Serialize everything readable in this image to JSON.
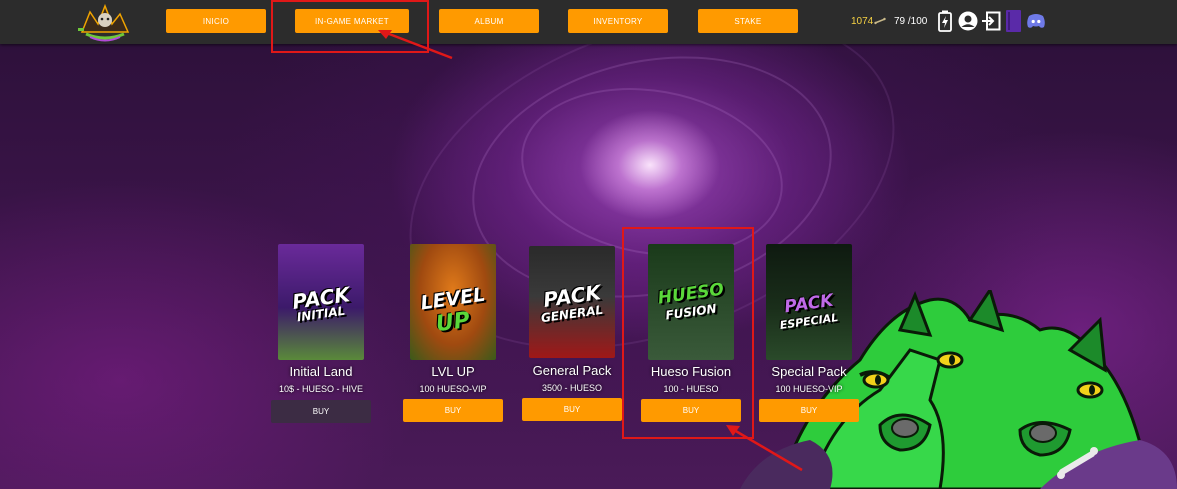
{
  "nav": {
    "items": [
      {
        "label": "INICIO"
      },
      {
        "label": "IN-GAME MARKET"
      },
      {
        "label": "ALBUM"
      },
      {
        "label": "INVENTORY"
      },
      {
        "label": "STAKE"
      }
    ]
  },
  "hud": {
    "currency_value": "1074",
    "energy": "79 /100"
  },
  "cards": [
    {
      "name": "Initial Land",
      "price": "10$ - HUESO - HIVE",
      "buy_label": "BUY",
      "pack_line1": "PACK",
      "pack_line2": "INITIAL"
    },
    {
      "name": "LVL UP",
      "price": "100 HUESO-VIP",
      "buy_label": "BUY",
      "pack_line1": "LEVEL",
      "pack_line2": "UP"
    },
    {
      "name": "General Pack",
      "price": "3500 - HUESO",
      "buy_label": "BUY",
      "pack_line1": "PACK",
      "pack_line2": "GENERAL"
    },
    {
      "name": "Hueso Fusion",
      "price": "100 - HUESO",
      "buy_label": "BUY",
      "pack_line1": "HUESO",
      "pack_line2": "FUSION"
    },
    {
      "name": "Special Pack",
      "price": "100 HUESO-VIP",
      "buy_label": "BUY",
      "pack_line1": "PACK",
      "pack_line2": "ESPECIAL"
    }
  ],
  "colors": {
    "accent": "#ff9a00",
    "topbar": "#2c2c2c",
    "annotation": "#e01818",
    "gold": "#f6d243"
  },
  "icons": [
    "logo",
    "energy-icon",
    "user-icon",
    "logout-icon",
    "book-icon",
    "discord-icon"
  ]
}
